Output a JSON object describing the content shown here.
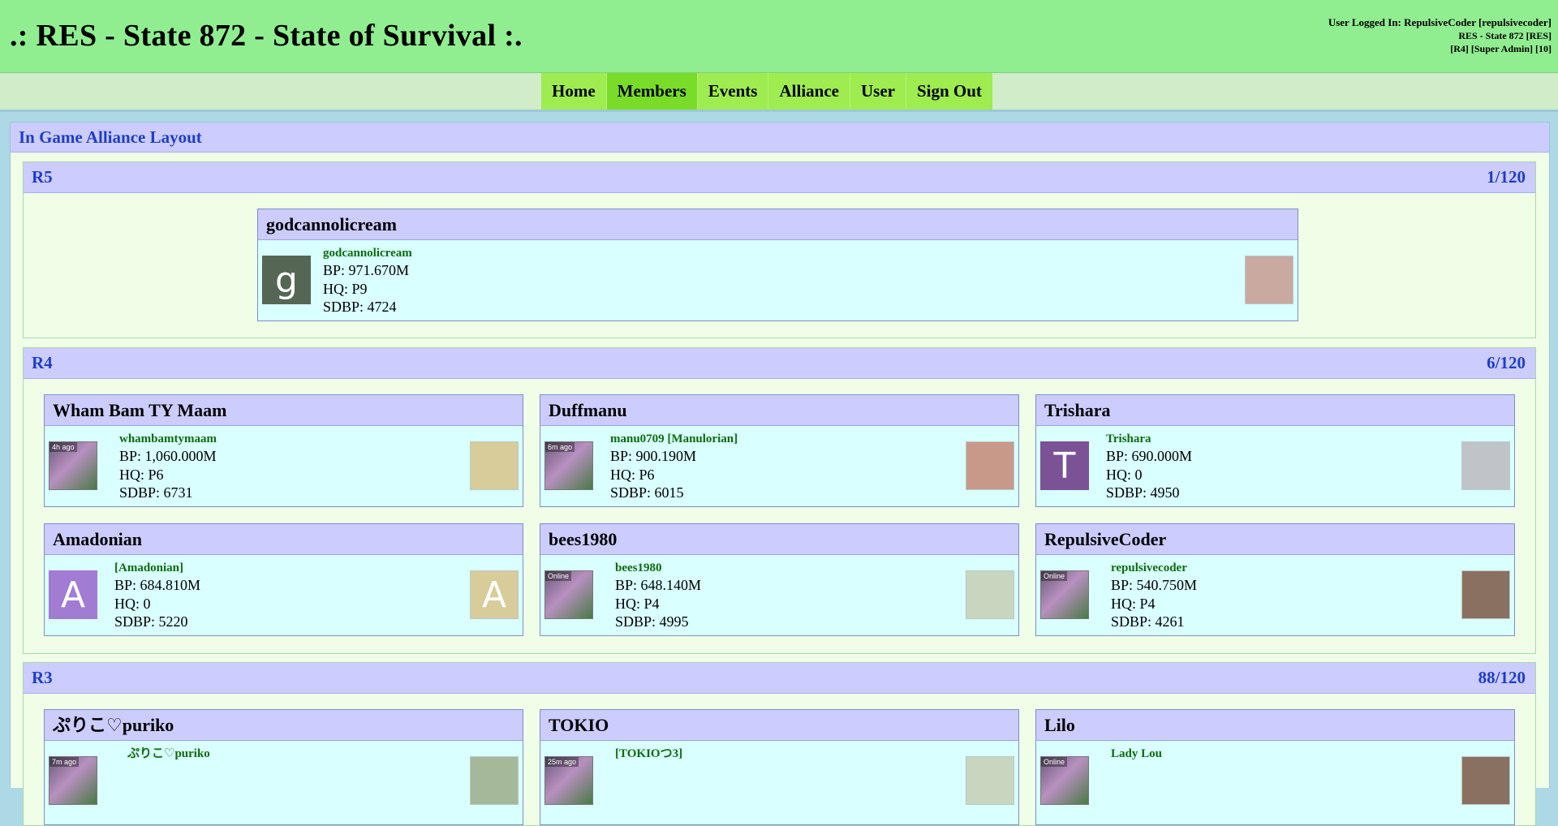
{
  "site": {
    "title": ".: RES - State 872 - State of Survival :.",
    "login": {
      "line1": "User Logged In: RepulsiveCoder [repulsivecoder]",
      "line2": "RES - State 872 [RES]",
      "line3": "[R4] [Super Admin] [10]"
    }
  },
  "nav": {
    "home": "Home",
    "members": "Members",
    "events": "Events",
    "alliance": "Alliance",
    "user": "User",
    "sign_out": "Sign Out",
    "active": "Members"
  },
  "main": {
    "title": "In Game Alliance Layout",
    "sections": [
      {
        "rank": "R5",
        "count": "1/120",
        "members": [
          {
            "title": "godcannolicream",
            "name": "godcannolicream",
            "bp": "BP: 971.670M",
            "hq": "HQ: P9",
            "sdbp": "SDBP: 4724",
            "avatar_letter": "g",
            "avatar_color": "#556655"
          }
        ]
      },
      {
        "rank": "R4",
        "count": "6/120",
        "members": [
          {
            "title": "Wham Bam TY Maam",
            "name": "whambamtymaam",
            "bp": "BP: 1,060.000M",
            "hq": "HQ: P6",
            "sdbp": "SDBP: 6731",
            "avatar_tag": "4h ago"
          },
          {
            "title": "Duffmanu",
            "name": "manu0709 [Manulorian]",
            "bp": "BP: 900.190M",
            "hq": "HQ: P6",
            "sdbp": "SDBP: 6015",
            "avatar_tag": "6m ago"
          },
          {
            "title": "Trishara",
            "name": "Trishara",
            "bp": "BP: 690.000M",
            "hq": "HQ: 0",
            "sdbp": "SDBP: 4950",
            "avatar_letter": "T",
            "avatar_color": "#7b5296"
          },
          {
            "title": "Amadonian",
            "name": "[Amadonian]",
            "bp": "BP: 684.810M",
            "hq": "HQ: 0",
            "sdbp": "SDBP: 5220",
            "avatar_letter": "A",
            "avatar_color": "#a27bd2",
            "photo_letter": "A",
            "photo_color": "#d8cc9a"
          },
          {
            "title": "bees1980",
            "name": "bees1980",
            "bp": "BP: 648.140M",
            "hq": "HQ: P4",
            "sdbp": "SDBP: 4995",
            "avatar_tag": "Online"
          },
          {
            "title": "RepulsiveCoder",
            "name": "repulsivecoder",
            "bp": "BP: 540.750M",
            "hq": "HQ: P4",
            "sdbp": "SDBP: 4261",
            "avatar_tag": "Online"
          }
        ]
      },
      {
        "rank": "R3",
        "count": "88/120",
        "members": [
          {
            "title": "ぷりこ♡puriko",
            "name": "ぷりこ♡puriko",
            "avatar_tag": "7m ago"
          },
          {
            "title": "TOKIO",
            "name": "[TOKIOつ3]",
            "avatar_tag": "25m ago"
          },
          {
            "title": "Lilo",
            "name": "Lady Lou",
            "avatar_tag": "Online"
          }
        ]
      }
    ]
  }
}
